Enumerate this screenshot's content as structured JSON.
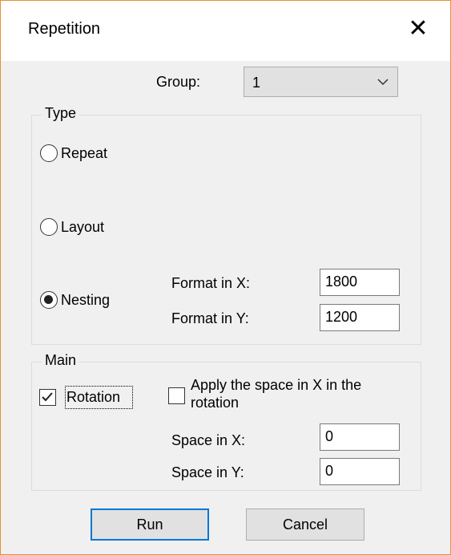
{
  "window": {
    "title": "Repetition",
    "close_symbol": "✕"
  },
  "group_select": {
    "label": "Group:",
    "value": "1"
  },
  "type_section": {
    "legend": "Type",
    "options": [
      {
        "label": "Repeat",
        "selected": false
      },
      {
        "label": "Layout",
        "selected": false
      },
      {
        "label": "Nesting",
        "selected": true
      }
    ],
    "format_x_label": "Format in X:",
    "format_x_value": "1800",
    "format_y_label": "Format in Y:",
    "format_y_value": "1200"
  },
  "main_section": {
    "legend": "Main",
    "rotation_label": "Rotation",
    "rotation_checked": true,
    "apply_space_label_line1": "Apply the space in X in the",
    "apply_space_label_line2": "rotation",
    "apply_space_checked": false,
    "space_x_label": "Space in X:",
    "space_x_value": "0",
    "space_y_label": "Space in Y:",
    "space_y_value": "0"
  },
  "buttons": {
    "run_label": "Run",
    "cancel_label": "Cancel"
  }
}
